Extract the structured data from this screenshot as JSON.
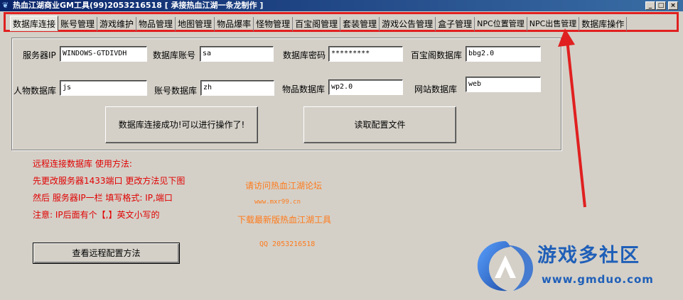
{
  "window": {
    "title": "热血江湖商业GM工具(99)2053216518 [ 承接热血江湖一条龙制作 ]",
    "icon": "app-icon",
    "minimize_glyph": "_",
    "maximize_glyph": "□",
    "close_glyph": "×"
  },
  "tabs": [
    {
      "label": "数据库连接",
      "active": true
    },
    {
      "label": "账号管理"
    },
    {
      "label": "游戏维护"
    },
    {
      "label": "物品管理"
    },
    {
      "label": "地图管理"
    },
    {
      "label": "物品爆率"
    },
    {
      "label": "怪物管理"
    },
    {
      "label": "百宝阁管理"
    },
    {
      "label": "套装管理"
    },
    {
      "label": "游戏公告管理"
    },
    {
      "label": "盒子管理"
    },
    {
      "label": "NPC位置管理"
    },
    {
      "label": "NPC出售管理"
    },
    {
      "label": "数据库操作"
    }
  ],
  "form": {
    "server_ip": {
      "label": "服务器IP",
      "value": "WINDOWS-GTDIVDH"
    },
    "db_account": {
      "label": "数据库账号",
      "value": "sa"
    },
    "db_password": {
      "label": "数据库密码",
      "value": "*********"
    },
    "treasure_db": {
      "label": "百宝阁数据库",
      "value": "bbg2.0"
    },
    "character_db": {
      "label": "人物数据库",
      "value": "js"
    },
    "account_db": {
      "label": "账号数据库",
      "value": "zh"
    },
    "item_db": {
      "label": "物品数据库",
      "value": "wp2.0"
    },
    "website_db": {
      "label": "网站数据库",
      "value": "web"
    },
    "status_button": "数据库连接成功!可以进行操作了!",
    "read_config_button": "读取配置文件"
  },
  "instructions": {
    "line1": "远程连接数据库 使用方法:",
    "line2": "先更改服务器1433端口  更改方法见下图",
    "line3": "然后 服务器IP一栏 填写格式: IP,端口",
    "line4": "注意: IP后面有个【,】英文小写的"
  },
  "remote_config_button": "查看远程配置方法",
  "promo": {
    "line1": "请访问热血江湖论坛",
    "url": "www.mxr99.cn",
    "line2": "下载最新版热血江湖工具",
    "qq": "QQ 2053216518"
  },
  "watermark": {
    "text": "游戏多社区",
    "url": "www.gmduo.com"
  },
  "colors": {
    "annotation_red": "#e02020",
    "instruction_red": "#e00000",
    "promo_orange": "#ff7a1a",
    "watermark_blue": "#1f5fb8"
  }
}
